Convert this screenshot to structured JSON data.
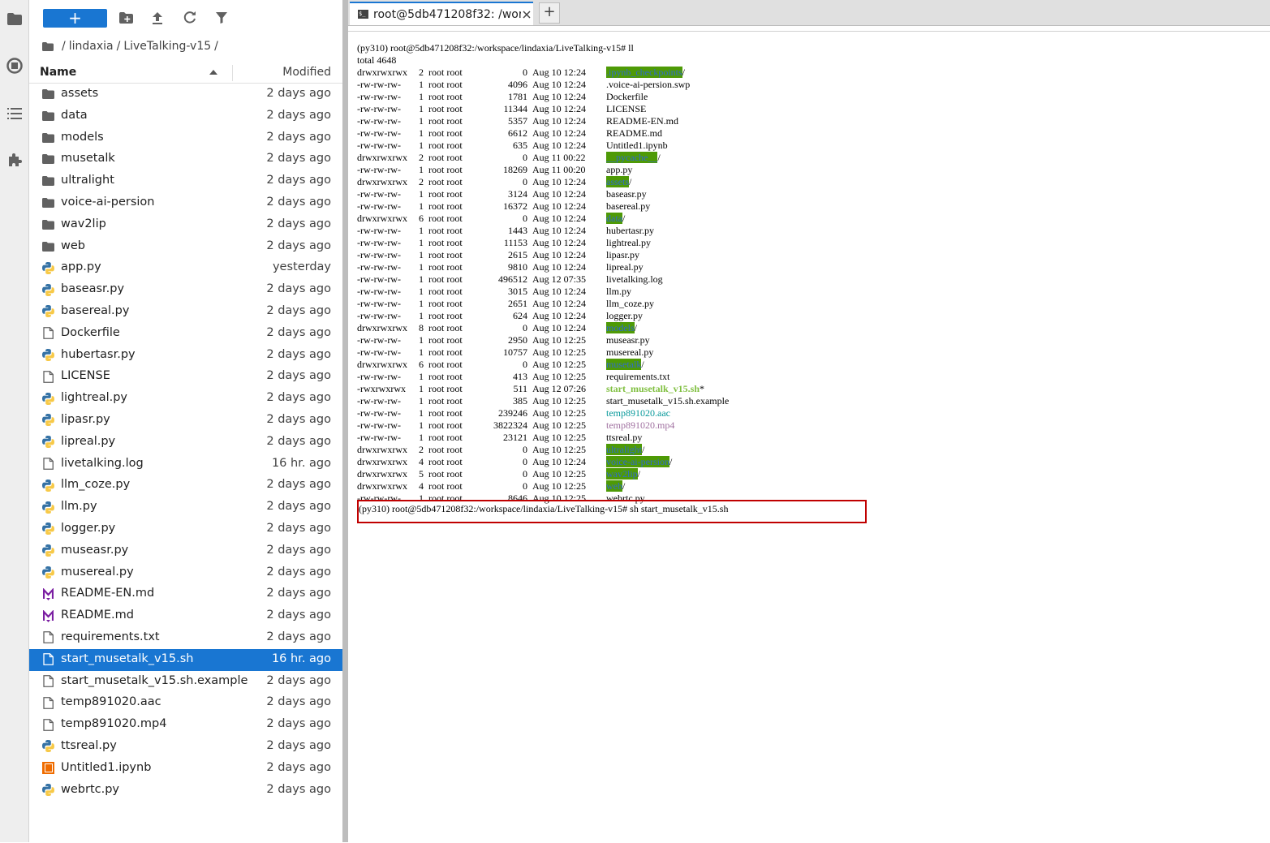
{
  "file_browser": {
    "new_label": "+",
    "breadcrumb": {
      "root_sep": "/",
      "parts": [
        "lindaxia",
        "LiveTalking-v15"
      ],
      "trailing_sep": "/"
    },
    "header": {
      "name": "Name",
      "modified": "Modified"
    },
    "files": [
      {
        "name": "assets",
        "modified": "2 days ago",
        "type": "folder"
      },
      {
        "name": "data",
        "modified": "2 days ago",
        "type": "folder"
      },
      {
        "name": "models",
        "modified": "2 days ago",
        "type": "folder"
      },
      {
        "name": "musetalk",
        "modified": "2 days ago",
        "type": "folder"
      },
      {
        "name": "ultralight",
        "modified": "2 days ago",
        "type": "folder"
      },
      {
        "name": "voice-ai-persion",
        "modified": "2 days ago",
        "type": "folder"
      },
      {
        "name": "wav2lip",
        "modified": "2 days ago",
        "type": "folder"
      },
      {
        "name": "web",
        "modified": "2 days ago",
        "type": "folder"
      },
      {
        "name": "app.py",
        "modified": "yesterday",
        "type": "python"
      },
      {
        "name": "baseasr.py",
        "modified": "2 days ago",
        "type": "python"
      },
      {
        "name": "basereal.py",
        "modified": "2 days ago",
        "type": "python"
      },
      {
        "name": "Dockerfile",
        "modified": "2 days ago",
        "type": "file"
      },
      {
        "name": "hubertasr.py",
        "modified": "2 days ago",
        "type": "python"
      },
      {
        "name": "LICENSE",
        "modified": "2 days ago",
        "type": "file"
      },
      {
        "name": "lightreal.py",
        "modified": "2 days ago",
        "type": "python"
      },
      {
        "name": "lipasr.py",
        "modified": "2 days ago",
        "type": "python"
      },
      {
        "name": "lipreal.py",
        "modified": "2 days ago",
        "type": "python"
      },
      {
        "name": "livetalking.log",
        "modified": "16 hr. ago",
        "type": "file"
      },
      {
        "name": "llm_coze.py",
        "modified": "2 days ago",
        "type": "python"
      },
      {
        "name": "llm.py",
        "modified": "2 days ago",
        "type": "python"
      },
      {
        "name": "logger.py",
        "modified": "2 days ago",
        "type": "python"
      },
      {
        "name": "museasr.py",
        "modified": "2 days ago",
        "type": "python"
      },
      {
        "name": "musereal.py",
        "modified": "2 days ago",
        "type": "python"
      },
      {
        "name": "README-EN.md",
        "modified": "2 days ago",
        "type": "markdown"
      },
      {
        "name": "README.md",
        "modified": "2 days ago",
        "type": "markdown"
      },
      {
        "name": "requirements.txt",
        "modified": "2 days ago",
        "type": "file"
      },
      {
        "name": "start_musetalk_v15.sh",
        "modified": "16 hr. ago",
        "type": "file",
        "selected": true
      },
      {
        "name": "start_musetalk_v15.sh.example",
        "modified": "2 days ago",
        "type": "file"
      },
      {
        "name": "temp891020.aac",
        "modified": "2 days ago",
        "type": "file"
      },
      {
        "name": "temp891020.mp4",
        "modified": "2 days ago",
        "type": "file"
      },
      {
        "name": "ttsreal.py",
        "modified": "2 days ago",
        "type": "python"
      },
      {
        "name": "Untitled1.ipynb",
        "modified": "2 days ago",
        "type": "notebook"
      },
      {
        "name": "webrtc.py",
        "modified": "2 days ago",
        "type": "python"
      }
    ]
  },
  "terminal_tab": {
    "label": "root@5db471208f32: /wor"
  },
  "terminal": {
    "first_prompt": "(py310) root@5db471208f32:/workspace/lindaxia/LiveTalking-v15# ll",
    "total": "total 4648",
    "entries": [
      {
        "perm": "drwxrwxrwx",
        "links": "2",
        "owner": "root root",
        "size": "0",
        "date": "Aug 10 12:24",
        "name": ".ipynb_checkpoints",
        "suffix": "/",
        "style": "dir"
      },
      {
        "perm": "-rw-rw-rw-",
        "links": "1",
        "owner": "root root",
        "size": "4096",
        "date": "Aug 10 12:24",
        "name": ".voice-ai-persion.swp",
        "suffix": "",
        "style": ""
      },
      {
        "perm": "-rw-rw-rw-",
        "links": "1",
        "owner": "root root",
        "size": "1781",
        "date": "Aug 10 12:24",
        "name": "Dockerfile",
        "suffix": "",
        "style": ""
      },
      {
        "perm": "-rw-rw-rw-",
        "links": "1",
        "owner": "root root",
        "size": "11344",
        "date": "Aug 10 12:24",
        "name": "LICENSE",
        "suffix": "",
        "style": ""
      },
      {
        "perm": "-rw-rw-rw-",
        "links": "1",
        "owner": "root root",
        "size": "5357",
        "date": "Aug 10 12:24",
        "name": "README-EN.md",
        "suffix": "",
        "style": ""
      },
      {
        "perm": "-rw-rw-rw-",
        "links": "1",
        "owner": "root root",
        "size": "6612",
        "date": "Aug 10 12:24",
        "name": "README.md",
        "suffix": "",
        "style": ""
      },
      {
        "perm": "-rw-rw-rw-",
        "links": "1",
        "owner": "root root",
        "size": "635",
        "date": "Aug 10 12:24",
        "name": "Untitled1.ipynb",
        "suffix": "",
        "style": ""
      },
      {
        "perm": "drwxrwxrwx",
        "links": "2",
        "owner": "root root",
        "size": "0",
        "date": "Aug 11 00:22",
        "name": "__pycache__",
        "suffix": "/",
        "style": "dir"
      },
      {
        "perm": "-rw-rw-rw-",
        "links": "1",
        "owner": "root root",
        "size": "18269",
        "date": "Aug 11 00:20",
        "name": "app.py",
        "suffix": "",
        "style": ""
      },
      {
        "perm": "drwxrwxrwx",
        "links": "2",
        "owner": "root root",
        "size": "0",
        "date": "Aug 10 12:24",
        "name": "assets",
        "suffix": "/",
        "style": "dir"
      },
      {
        "perm": "-rw-rw-rw-",
        "links": "1",
        "owner": "root root",
        "size": "3124",
        "date": "Aug 10 12:24",
        "name": "baseasr.py",
        "suffix": "",
        "style": ""
      },
      {
        "perm": "-rw-rw-rw-",
        "links": "1",
        "owner": "root root",
        "size": "16372",
        "date": "Aug 10 12:24",
        "name": "basereal.py",
        "suffix": "",
        "style": ""
      },
      {
        "perm": "drwxrwxrwx",
        "links": "6",
        "owner": "root root",
        "size": "0",
        "date": "Aug 10 12:24",
        "name": "data",
        "suffix": "/",
        "style": "dir"
      },
      {
        "perm": "-rw-rw-rw-",
        "links": "1",
        "owner": "root root",
        "size": "1443",
        "date": "Aug 10 12:24",
        "name": "hubertasr.py",
        "suffix": "",
        "style": ""
      },
      {
        "perm": "-rw-rw-rw-",
        "links": "1",
        "owner": "root root",
        "size": "11153",
        "date": "Aug 10 12:24",
        "name": "lightreal.py",
        "suffix": "",
        "style": ""
      },
      {
        "perm": "-rw-rw-rw-",
        "links": "1",
        "owner": "root root",
        "size": "2615",
        "date": "Aug 10 12:24",
        "name": "lipasr.py",
        "suffix": "",
        "style": ""
      },
      {
        "perm": "-rw-rw-rw-",
        "links": "1",
        "owner": "root root",
        "size": "9810",
        "date": "Aug 10 12:24",
        "name": "lipreal.py",
        "suffix": "",
        "style": ""
      },
      {
        "perm": "-rw-rw-rw-",
        "links": "1",
        "owner": "root root",
        "size": "496512",
        "date": "Aug 12 07:35",
        "name": "livetalking.log",
        "suffix": "",
        "style": ""
      },
      {
        "perm": "-rw-rw-rw-",
        "links": "1",
        "owner": "root root",
        "size": "3015",
        "date": "Aug 10 12:24",
        "name": "llm.py",
        "suffix": "",
        "style": ""
      },
      {
        "perm": "-rw-rw-rw-",
        "links": "1",
        "owner": "root root",
        "size": "2651",
        "date": "Aug 10 12:24",
        "name": "llm_coze.py",
        "suffix": "",
        "style": ""
      },
      {
        "perm": "-rw-rw-rw-",
        "links": "1",
        "owner": "root root",
        "size": "624",
        "date": "Aug 10 12:24",
        "name": "logger.py",
        "suffix": "",
        "style": ""
      },
      {
        "perm": "drwxrwxrwx",
        "links": "8",
        "owner": "root root",
        "size": "0",
        "date": "Aug 10 12:24",
        "name": "models",
        "suffix": "/",
        "style": "dir"
      },
      {
        "perm": "-rw-rw-rw-",
        "links": "1",
        "owner": "root root",
        "size": "2950",
        "date": "Aug 10 12:25",
        "name": "museasr.py",
        "suffix": "",
        "style": ""
      },
      {
        "perm": "-rw-rw-rw-",
        "links": "1",
        "owner": "root root",
        "size": "10757",
        "date": "Aug 10 12:25",
        "name": "musereal.py",
        "suffix": "",
        "style": ""
      },
      {
        "perm": "drwxrwxrwx",
        "links": "6",
        "owner": "root root",
        "size": "0",
        "date": "Aug 10 12:25",
        "name": "musetalk",
        "suffix": "/",
        "style": "dir"
      },
      {
        "perm": "-rw-rw-rw-",
        "links": "1",
        "owner": "root root",
        "size": "413",
        "date": "Aug 10 12:25",
        "name": "requirements.txt",
        "suffix": "",
        "style": ""
      },
      {
        "perm": "-rwxrwxrwx",
        "links": "1",
        "owner": "root root",
        "size": "511",
        "date": "Aug 12 07:26",
        "name": "start_musetalk_v15.sh",
        "suffix": "*",
        "style": "exec"
      },
      {
        "perm": "-rw-rw-rw-",
        "links": "1",
        "owner": "root root",
        "size": "385",
        "date": "Aug 10 12:25",
        "name": "start_musetalk_v15.sh.example",
        "suffix": "",
        "style": ""
      },
      {
        "perm": "-rw-rw-rw-",
        "links": "1",
        "owner": "root root",
        "size": "239246",
        "date": "Aug 10 12:25",
        "name": "temp891020.aac",
        "suffix": "",
        "style": "aac"
      },
      {
        "perm": "-rw-rw-rw-",
        "links": "1",
        "owner": "root root",
        "size": "3822324",
        "date": "Aug 10 12:25",
        "name": "temp891020.mp4",
        "suffix": "",
        "style": "mp4"
      },
      {
        "perm": "-rw-rw-rw-",
        "links": "1",
        "owner": "root root",
        "size": "23121",
        "date": "Aug 10 12:25",
        "name": "ttsreal.py",
        "suffix": "",
        "style": ""
      },
      {
        "perm": "drwxrwxrwx",
        "links": "2",
        "owner": "root root",
        "size": "0",
        "date": "Aug 10 12:25",
        "name": "ultralight",
        "suffix": "/",
        "style": "dir"
      },
      {
        "perm": "drwxrwxrwx",
        "links": "4",
        "owner": "root root",
        "size": "0",
        "date": "Aug 10 12:24",
        "name": "voice-ai-persion",
        "suffix": "/",
        "style": "dir"
      },
      {
        "perm": "drwxrwxrwx",
        "links": "5",
        "owner": "root root",
        "size": "0",
        "date": "Aug 10 12:25",
        "name": "wav2lip",
        "suffix": "/",
        "style": "dir"
      },
      {
        "perm": "drwxrwxrwx",
        "links": "4",
        "owner": "root root",
        "size": "0",
        "date": "Aug 10 12:25",
        "name": "web",
        "suffix": "/",
        "style": "dir"
      },
      {
        "perm": "-rw-rw-rw-",
        "links": "1",
        "owner": "root root",
        "size": "8646",
        "date": "Aug 10 12:25",
        "name": "webrtc.py",
        "suffix": "",
        "style": ""
      }
    ],
    "command_line": "(py310) root@5db471208f32:/workspace/lindaxia/LiveTalking-v15# sh start_musetalk_v15.sh"
  },
  "colors": {
    "accent": "#1976d2",
    "highlight_box": "#c00000",
    "dir_bg": "#4e9a06"
  },
  "icons": {
    "activity": [
      "folder-icon",
      "running-icon",
      "toc-icon",
      "extension-icon"
    ],
    "toolbar": [
      "new-folder-icon",
      "upload-icon",
      "refresh-icon",
      "filter-icon"
    ]
  }
}
